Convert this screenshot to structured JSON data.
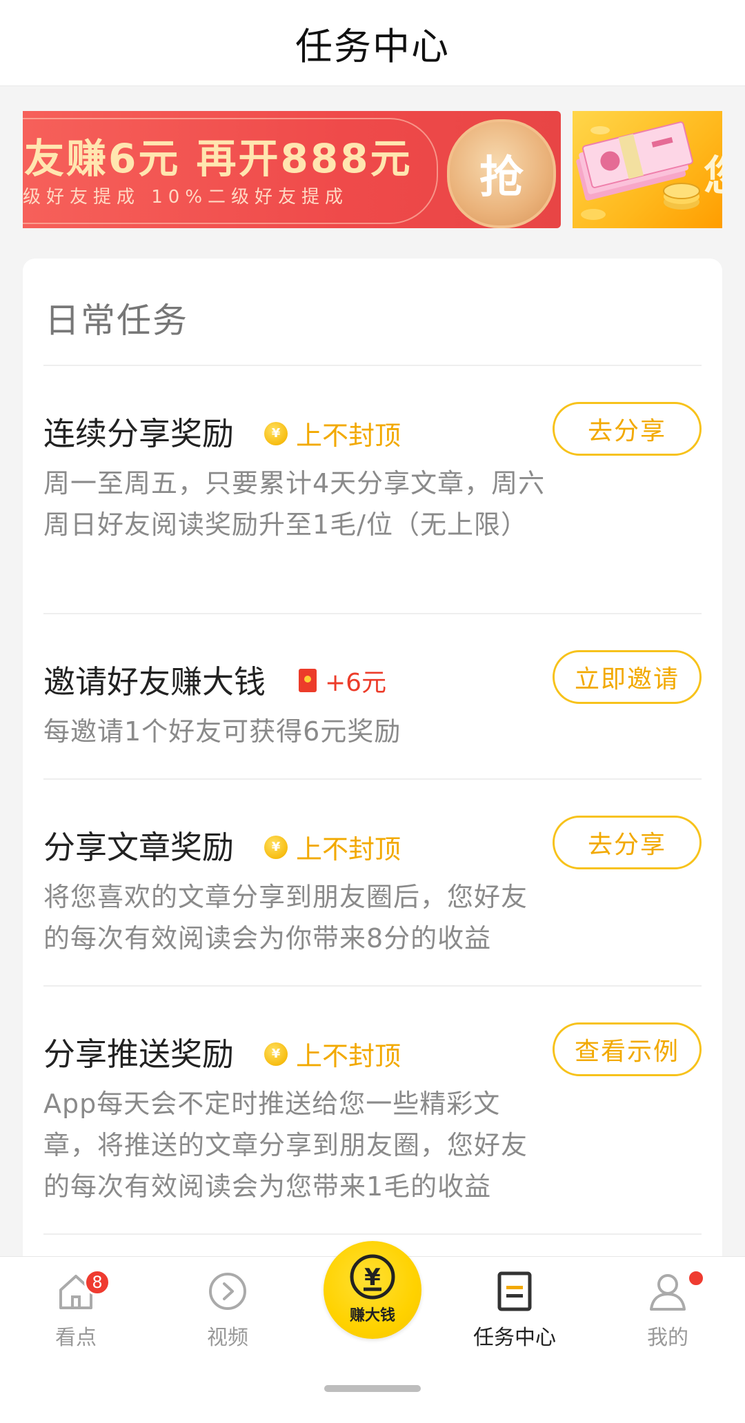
{
  "header": {
    "title": "任务中心"
  },
  "banner": {
    "title": "友赚6元 再开888元",
    "subtitle": "级好友提成 10%二级好友提成",
    "grab_label": "抢",
    "side_text": "您"
  },
  "section": {
    "title": "日常任务"
  },
  "tasks": [
    {
      "title": "连续分享奖励",
      "badge_icon": "coin-icon",
      "badge": "上不封顶",
      "description": "周一至周五，只要累计4天分享文章，周六周日好友阅读奖励升至1毛/位（无上限）",
      "button": "去分享"
    },
    {
      "title": "邀请好友赚大钱",
      "badge_icon": "red-packet-icon",
      "badge": "+6元",
      "description": "每邀请1个好友可获得6元奖励",
      "button": "立即邀请"
    },
    {
      "title": "分享文章奖励",
      "badge_icon": "coin-icon",
      "badge": "上不封顶",
      "description": "将您喜欢的文章分享到朋友圈后，您好友的每次有效阅读会为你带来8分的收益",
      "button": "去分享"
    },
    {
      "title": "分享推送奖励",
      "badge_icon": "coin-icon",
      "badge": "上不封顶",
      "description": "App每天会不定时推送给您一些精彩文章，将推送的文章分享到朋友圈，您好友的每次有效阅读会为您带来1毛的收益",
      "button": "查看示例"
    }
  ],
  "coin_symbol": "¥",
  "tabbar": {
    "items": [
      {
        "label": "看点",
        "icon": "home-icon",
        "badge": "8"
      },
      {
        "label": "视频",
        "icon": "play-circle-icon"
      },
      {
        "label": "赚大钱",
        "icon": "yuan-coin-icon"
      },
      {
        "label": "任务中心",
        "icon": "task-list-icon",
        "active": true
      },
      {
        "label": "我的",
        "icon": "user-icon"
      }
    ]
  },
  "colors": {
    "accent": "#f7c21b",
    "accent_text": "#f2a900",
    "red": "#ec3c2a",
    "banner_red": "#ef4a4a"
  }
}
